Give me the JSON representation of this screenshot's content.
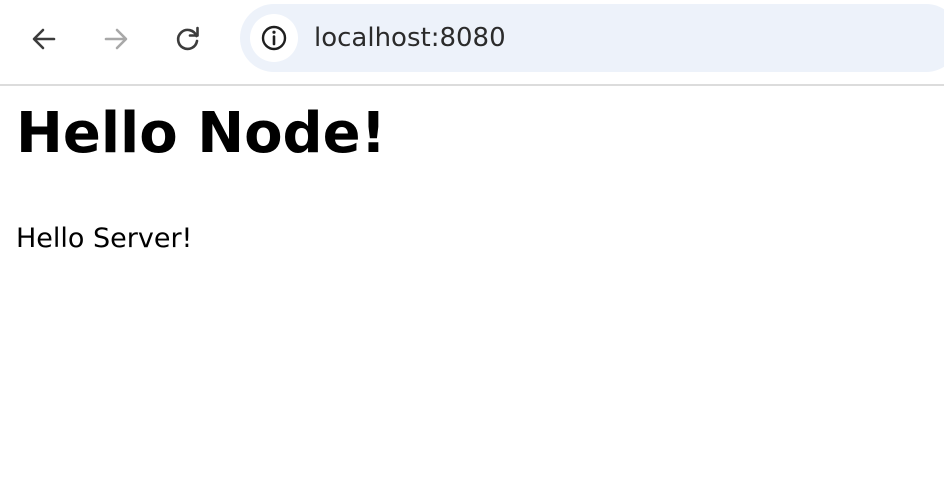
{
  "browser": {
    "address_bar": {
      "url": "localhost:8080",
      "site_info_icon": "info-icon"
    },
    "buttons": {
      "back_icon": "arrow-left-icon",
      "forward_icon": "arrow-right-icon",
      "reload_icon": "reload-icon"
    },
    "colors": {
      "omnibox_bg": "#edf2fa",
      "icon_active": "#3c3c3c",
      "icon_disabled": "#a8a8a8"
    }
  },
  "page": {
    "heading": "Hello Node!",
    "paragraph": "Hello Server!"
  }
}
